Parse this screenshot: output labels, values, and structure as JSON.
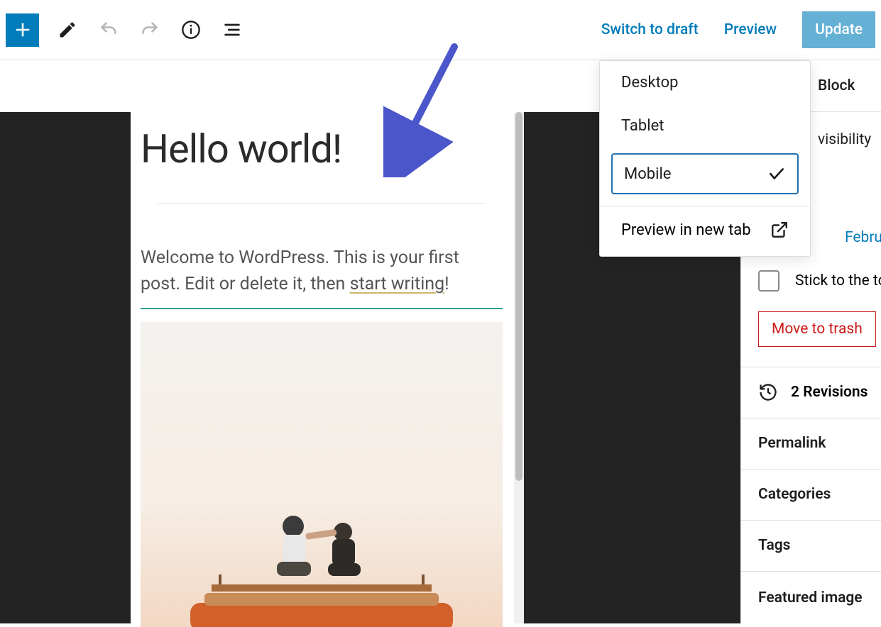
{
  "toolbar": {
    "switch_to_draft": "Switch to draft",
    "preview": "Preview",
    "update": "Update"
  },
  "preview_menu": {
    "desktop": "Desktop",
    "tablet": "Tablet",
    "mobile": "Mobile",
    "new_tab": "Preview in new tab"
  },
  "post": {
    "title": "Hello world!",
    "body_prefix": "Welcome to WordPress. This is your first post. Edit or delete it, then ",
    "body_link": "start writing",
    "body_suffix": "!"
  },
  "sidebar": {
    "tab_block": "Block",
    "visibility_label": "visibility",
    "date_label": "Febru",
    "stick_label": "Stick to the to",
    "trash_label": "Move to trash",
    "revisions_label": "2 Revisions",
    "panels": {
      "permalink": "Permalink",
      "categories": "Categories",
      "tags": "Tags",
      "featured": "Featured image"
    }
  }
}
